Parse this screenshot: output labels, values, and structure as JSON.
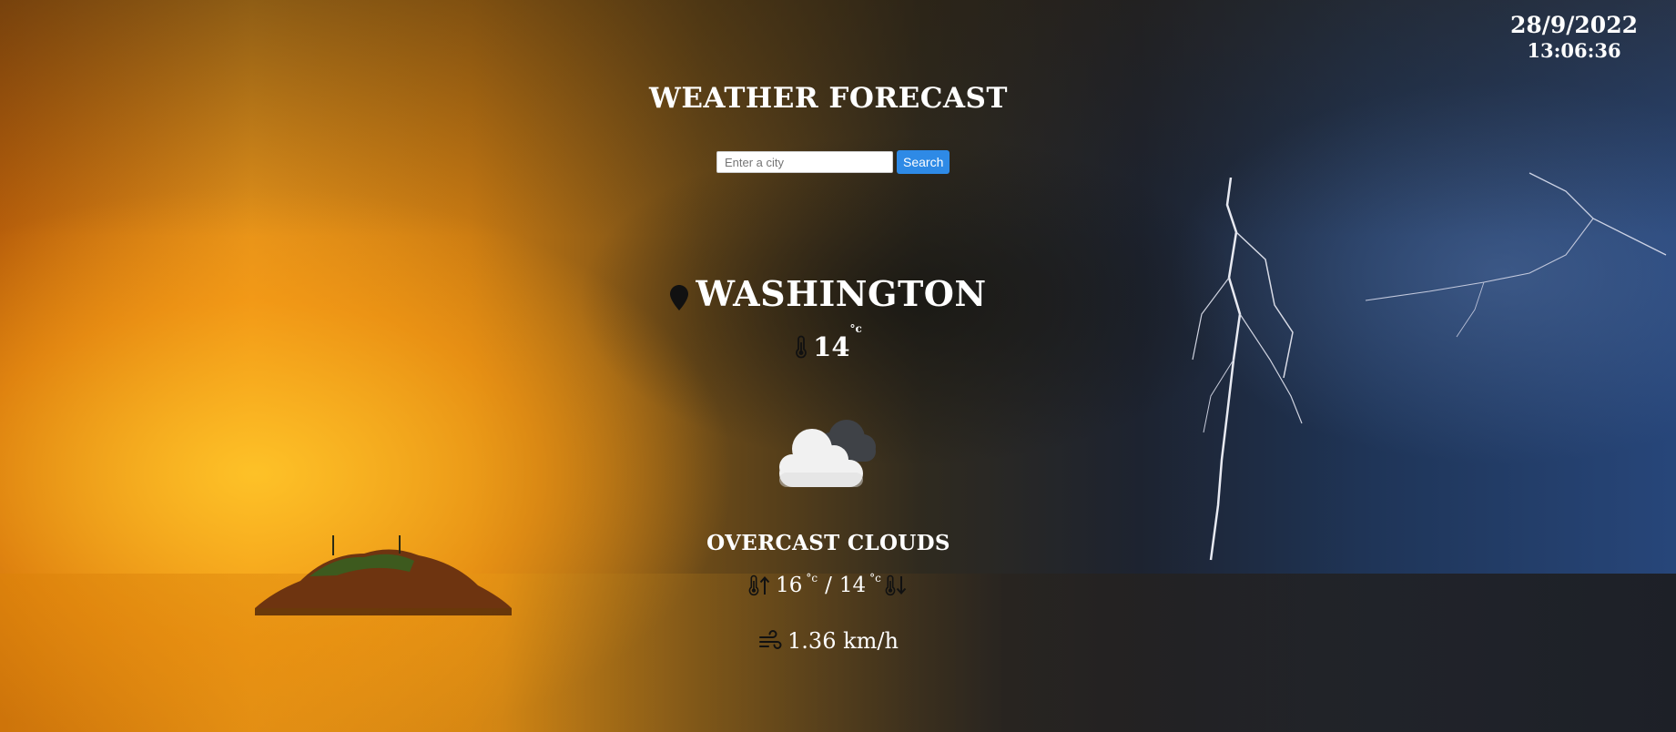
{
  "datetime": {
    "date": "28/9/2022",
    "time": "13:06:36"
  },
  "header": {
    "title": "WEATHER FORECAST"
  },
  "search": {
    "placeholder": "Enter a city",
    "value": "",
    "button_label": "Search"
  },
  "weather": {
    "city": "WASHINGTON",
    "temperature": "14",
    "temperature_unit": "°c",
    "condition_icon": "overcast-clouds-icon",
    "description": "OVERCAST CLOUDS",
    "temp_max": "16",
    "temp_min": "14",
    "temp_unit": "°c",
    "separator": "/",
    "wind_speed": "1.36 km/h"
  },
  "icons": {
    "location": "map-pin-icon",
    "thermometer": "thermometer-icon",
    "temp_max": "thermometer-up-icon",
    "temp_min": "thermometer-down-icon",
    "wind": "wind-icon"
  },
  "colors": {
    "search_button": "#2e8ae6",
    "text": "#ffffff"
  }
}
